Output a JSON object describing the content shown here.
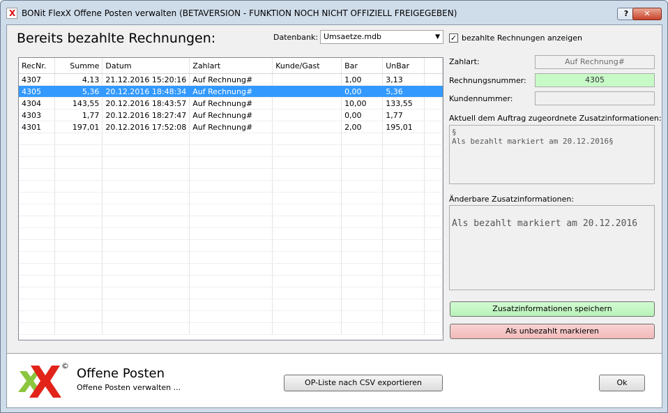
{
  "window": {
    "title": "BONit FlexX Offene Posten verwalten (BETAVERSION - FUNKTION NOCH NICHT OFFIZIELL FREIGEGEBEN)",
    "help_label": "?",
    "close_label": "✕"
  },
  "header": {
    "heading": "Bereits bezahlte Rechnungen:",
    "db_label": "Datenbank:",
    "db_value": "Umsaetze.mdb",
    "show_paid_label": "bezahlte Rechnungen anzeigen",
    "show_paid_checked": true
  },
  "table": {
    "columns": [
      "RecNr.",
      "Summe",
      "Datum",
      "Zahlart",
      "Kunde/Gast",
      "Bar",
      "UnBar"
    ],
    "rows": [
      [
        "4307",
        "4,13",
        "21.12.2016 15:20:16",
        "Auf Rechnung#",
        "",
        "1,00",
        "3,13"
      ],
      [
        "4305",
        "5,36",
        "20.12.2016 18:48:34",
        "Auf Rechnung#",
        "",
        "0,00",
        "5,36"
      ],
      [
        "4304",
        "143,55",
        "20.12.2016 18:43:57",
        "Auf Rechnung#",
        "",
        "10,00",
        "133,55"
      ],
      [
        "4303",
        "1,77",
        "20.12.2016 18:27:47",
        "Auf Rechnung#",
        "",
        "0,00",
        "1,77"
      ],
      [
        "4301",
        "197,01",
        "20.12.2016 17:52:08",
        "Auf Rechnung#",
        "",
        "2,00",
        "195,01"
      ]
    ],
    "selected_row": 1
  },
  "details": {
    "zahlart_label": "Zahlart:",
    "zahlart_value": "Auf Rechnung#",
    "rechnungsnummer_label": "Rechnungsnummer:",
    "rechnungsnummer_value": "4305",
    "kundennummer_label": "Kundennummer:",
    "kundennummer_value": "",
    "assigned_info_label": "Aktuell dem Auftrag zugeordnete Zusatzinformationen:",
    "assigned_info_value": "§\nAls bezahlt markiert am 20.12.2016§",
    "editable_info_label": "Änderbare Zusatzinformationen:",
    "editable_info_value": "\nAls bezahlt markiert am 20.12.2016",
    "save_button": "Zusatzinformationen speichern",
    "unpaid_button": "Als unbezahlt markieren"
  },
  "footer": {
    "title": "Offene Posten",
    "subtitle": "Offene Posten verwalten ...",
    "export_button": "OP-Liste nach CSV exportieren",
    "ok_button": "Ok",
    "logo_copyright": "©"
  },
  "colors": {
    "selection": "#3399ff",
    "green_field": "#c8fac8",
    "red_button": "#f2baba",
    "logo_green": "#8cc63f",
    "logo_red": "#e2231a"
  }
}
